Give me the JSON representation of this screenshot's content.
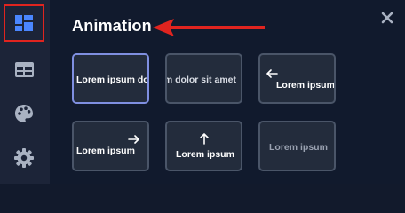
{
  "sidebar": {
    "items": [
      {
        "name": "dashboard",
        "icon": "dashboard-icon",
        "active": true
      },
      {
        "name": "layout",
        "icon": "table-icon",
        "active": false
      },
      {
        "name": "theme",
        "icon": "palette-icon",
        "active": false
      },
      {
        "name": "settings",
        "icon": "gear-icon",
        "active": false
      }
    ]
  },
  "panel": {
    "title": "Animation",
    "close_icon": "close-icon",
    "annotation_icon": "red-arrow-left-icon"
  },
  "cards": [
    {
      "label": "Lorem ipsum dolor sit amet",
      "variant": "fade-right",
      "selected": true
    },
    {
      "label": "Lorem ipsum dolor sit amet",
      "variant": "fade-left",
      "selected": false
    },
    {
      "label": "Lorem ipsum",
      "variant": "slide-left",
      "arrow": "arrow-left-icon",
      "selected": false
    },
    {
      "label": "Lorem ipsum",
      "variant": "slide-right",
      "arrow": "arrow-right-icon",
      "selected": false
    },
    {
      "label": "Lorem ipsum",
      "variant": "slide-up",
      "arrow": "arrow-up-icon",
      "selected": false
    },
    {
      "label": "Lorem ipsum",
      "variant": "fade",
      "selected": false
    }
  ],
  "colors": {
    "background": "#121a2c",
    "sidebar": "#1c2438",
    "active_outline": "#e0241f",
    "card_selected_border": "#7f8fe0",
    "card_border": "#4a5568"
  }
}
